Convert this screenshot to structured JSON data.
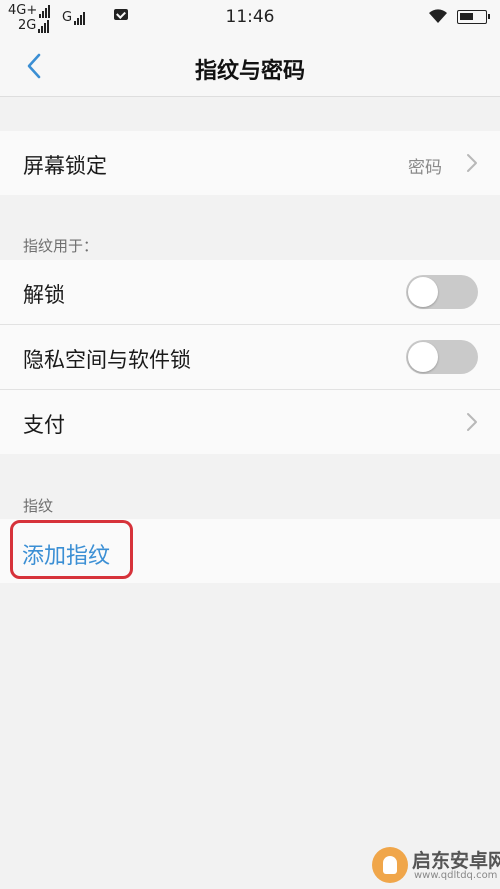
{
  "status_bar": {
    "network_1": "4G+",
    "network_2": "2G",
    "sim2": "G",
    "time": "11:46"
  },
  "header": {
    "title": "指纹与密码"
  },
  "screen_lock": {
    "label": "屏幕锁定",
    "value": "密码"
  },
  "fingerprint_usage": {
    "header": "指纹用于：",
    "items": [
      {
        "label": "解锁",
        "toggle_on": false
      },
      {
        "label": "隐私空间与软件锁",
        "toggle_on": false
      },
      {
        "label": "支付"
      }
    ]
  },
  "fingerprints": {
    "header": "指纹",
    "add_label": "添加指纹"
  },
  "watermark": {
    "brand": "启东安卓网",
    "url": "www.qdltdq.com"
  },
  "colors": {
    "accent": "#3b8fd4",
    "highlight": "#d6323a",
    "toggle_off": "#cacaca",
    "background": "#f2f2f2"
  }
}
